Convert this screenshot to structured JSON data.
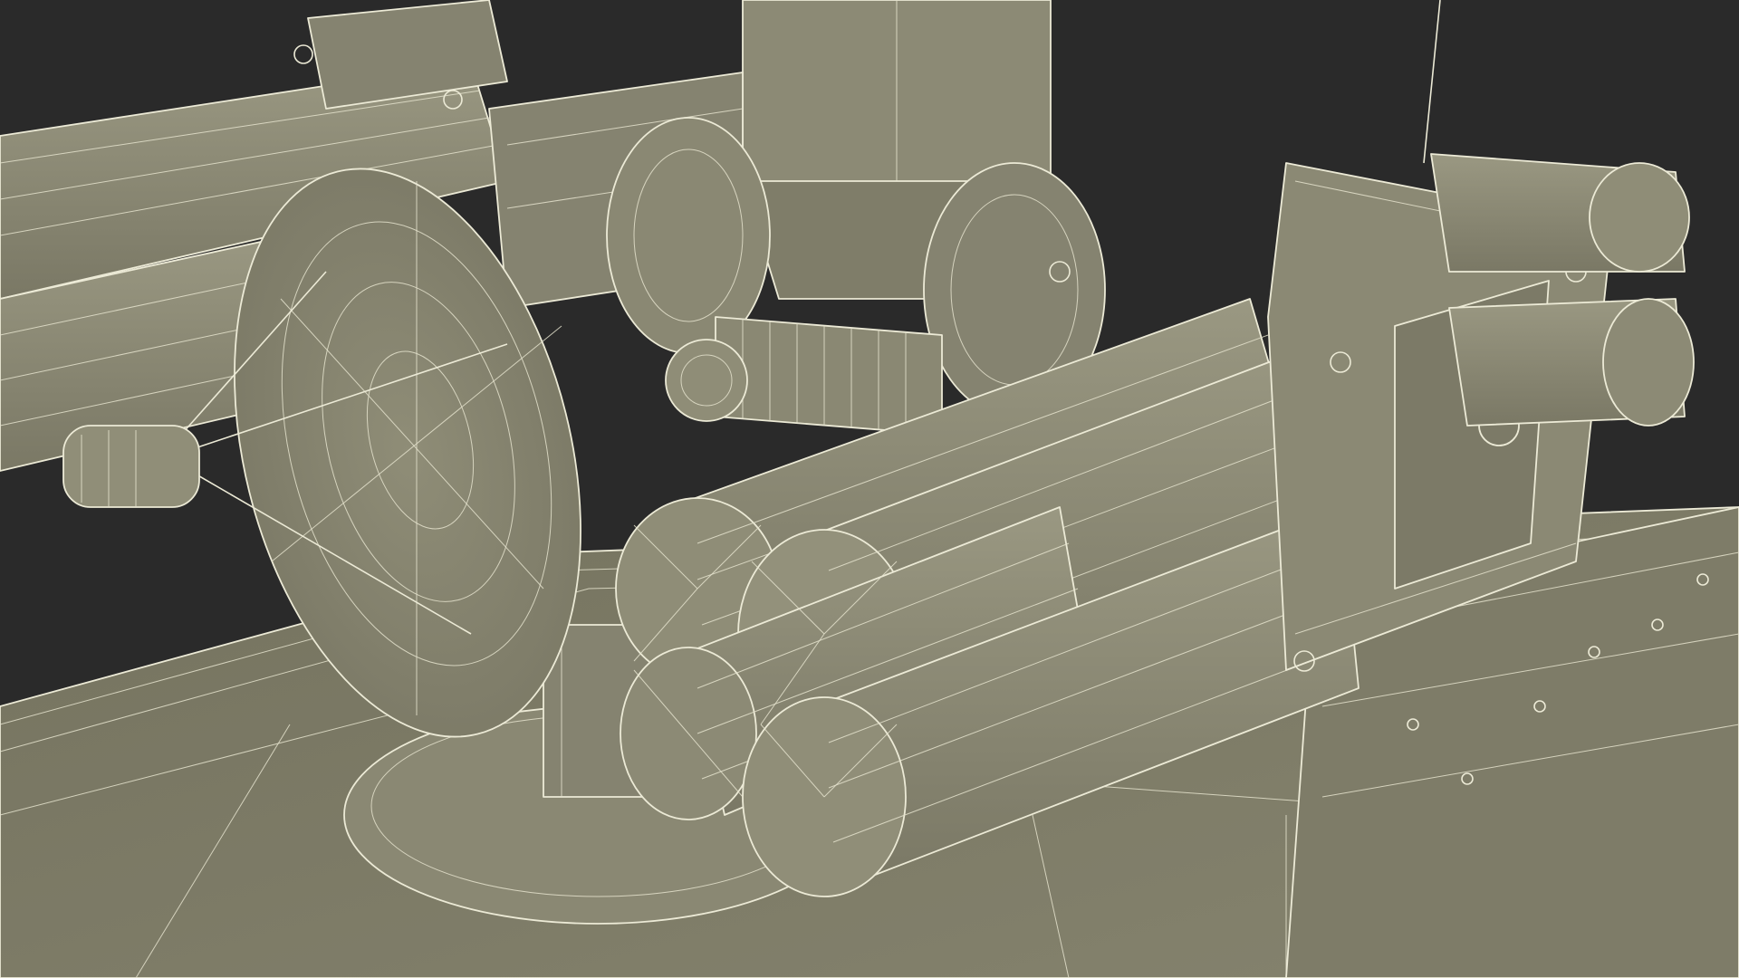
{
  "scene": {
    "background_color": "#2a2a2a",
    "wire_color": "#ecead6",
    "model_color": "#8d8b76",
    "model_shadow_color": "#6f6d5c",
    "model_highlight_color": "#9c9a84",
    "icons": [
      "launcher-tube-icon",
      "radar-dish-icon",
      "frame-icon",
      "turret-base-icon"
    ]
  }
}
